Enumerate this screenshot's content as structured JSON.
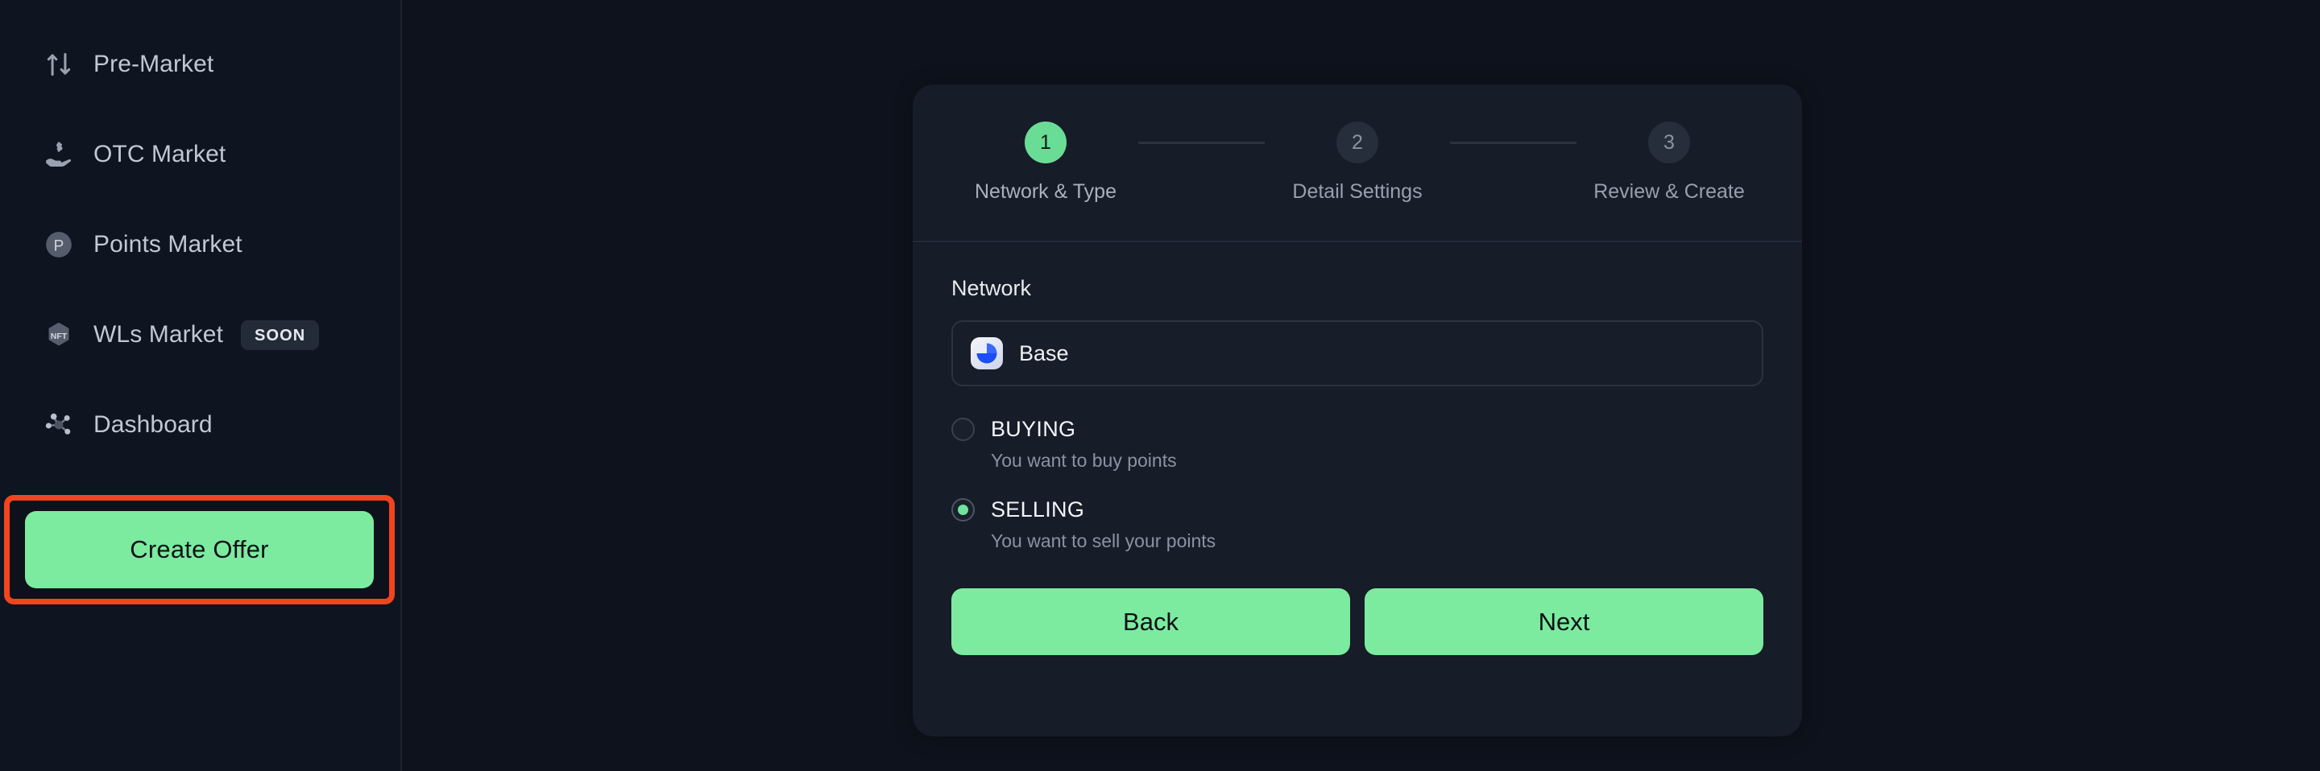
{
  "theme": {
    "page_bg": "#0d121c",
    "sidebar_bg": "#0e1420",
    "card_bg": "#161c28",
    "accent_green": "#7ceb9f",
    "step_active_green": "#69dd96",
    "highlight_red": "#f2441d",
    "text_primary": "#e7eaef",
    "text_muted": "#8b93a2"
  },
  "sidebar": {
    "items": [
      {
        "label": "Pre-Market",
        "icon": "swap-arrows-icon",
        "badge": null
      },
      {
        "label": "OTC Market",
        "icon": "hand-dollar-icon",
        "badge": null
      },
      {
        "label": "Points Market",
        "icon": "points-p-icon",
        "badge": null
      },
      {
        "label": "WLs Market",
        "icon": "nft-hexagon-icon",
        "badge": "SOON"
      },
      {
        "label": "Dashboard",
        "icon": "network-nodes-icon",
        "badge": null
      }
    ],
    "create_offer_label": "Create Offer"
  },
  "modal": {
    "stepper": {
      "steps": [
        {
          "number": "1",
          "label": "Network & Type",
          "state": "active"
        },
        {
          "number": "2",
          "label": "Detail Settings",
          "state": "inactive"
        },
        {
          "number": "3",
          "label": "Review & Create",
          "state": "inactive"
        }
      ]
    },
    "network": {
      "label": "Network",
      "selected_value": "Base",
      "logo_icon": "base-network-logo"
    },
    "offer_type": {
      "options": [
        {
          "title": "BUYING",
          "description": "You want to buy points",
          "selected": false
        },
        {
          "title": "SELLING",
          "description": "You want to sell your points",
          "selected": true
        }
      ]
    },
    "actions": {
      "back_label": "Back",
      "next_label": "Next"
    }
  }
}
